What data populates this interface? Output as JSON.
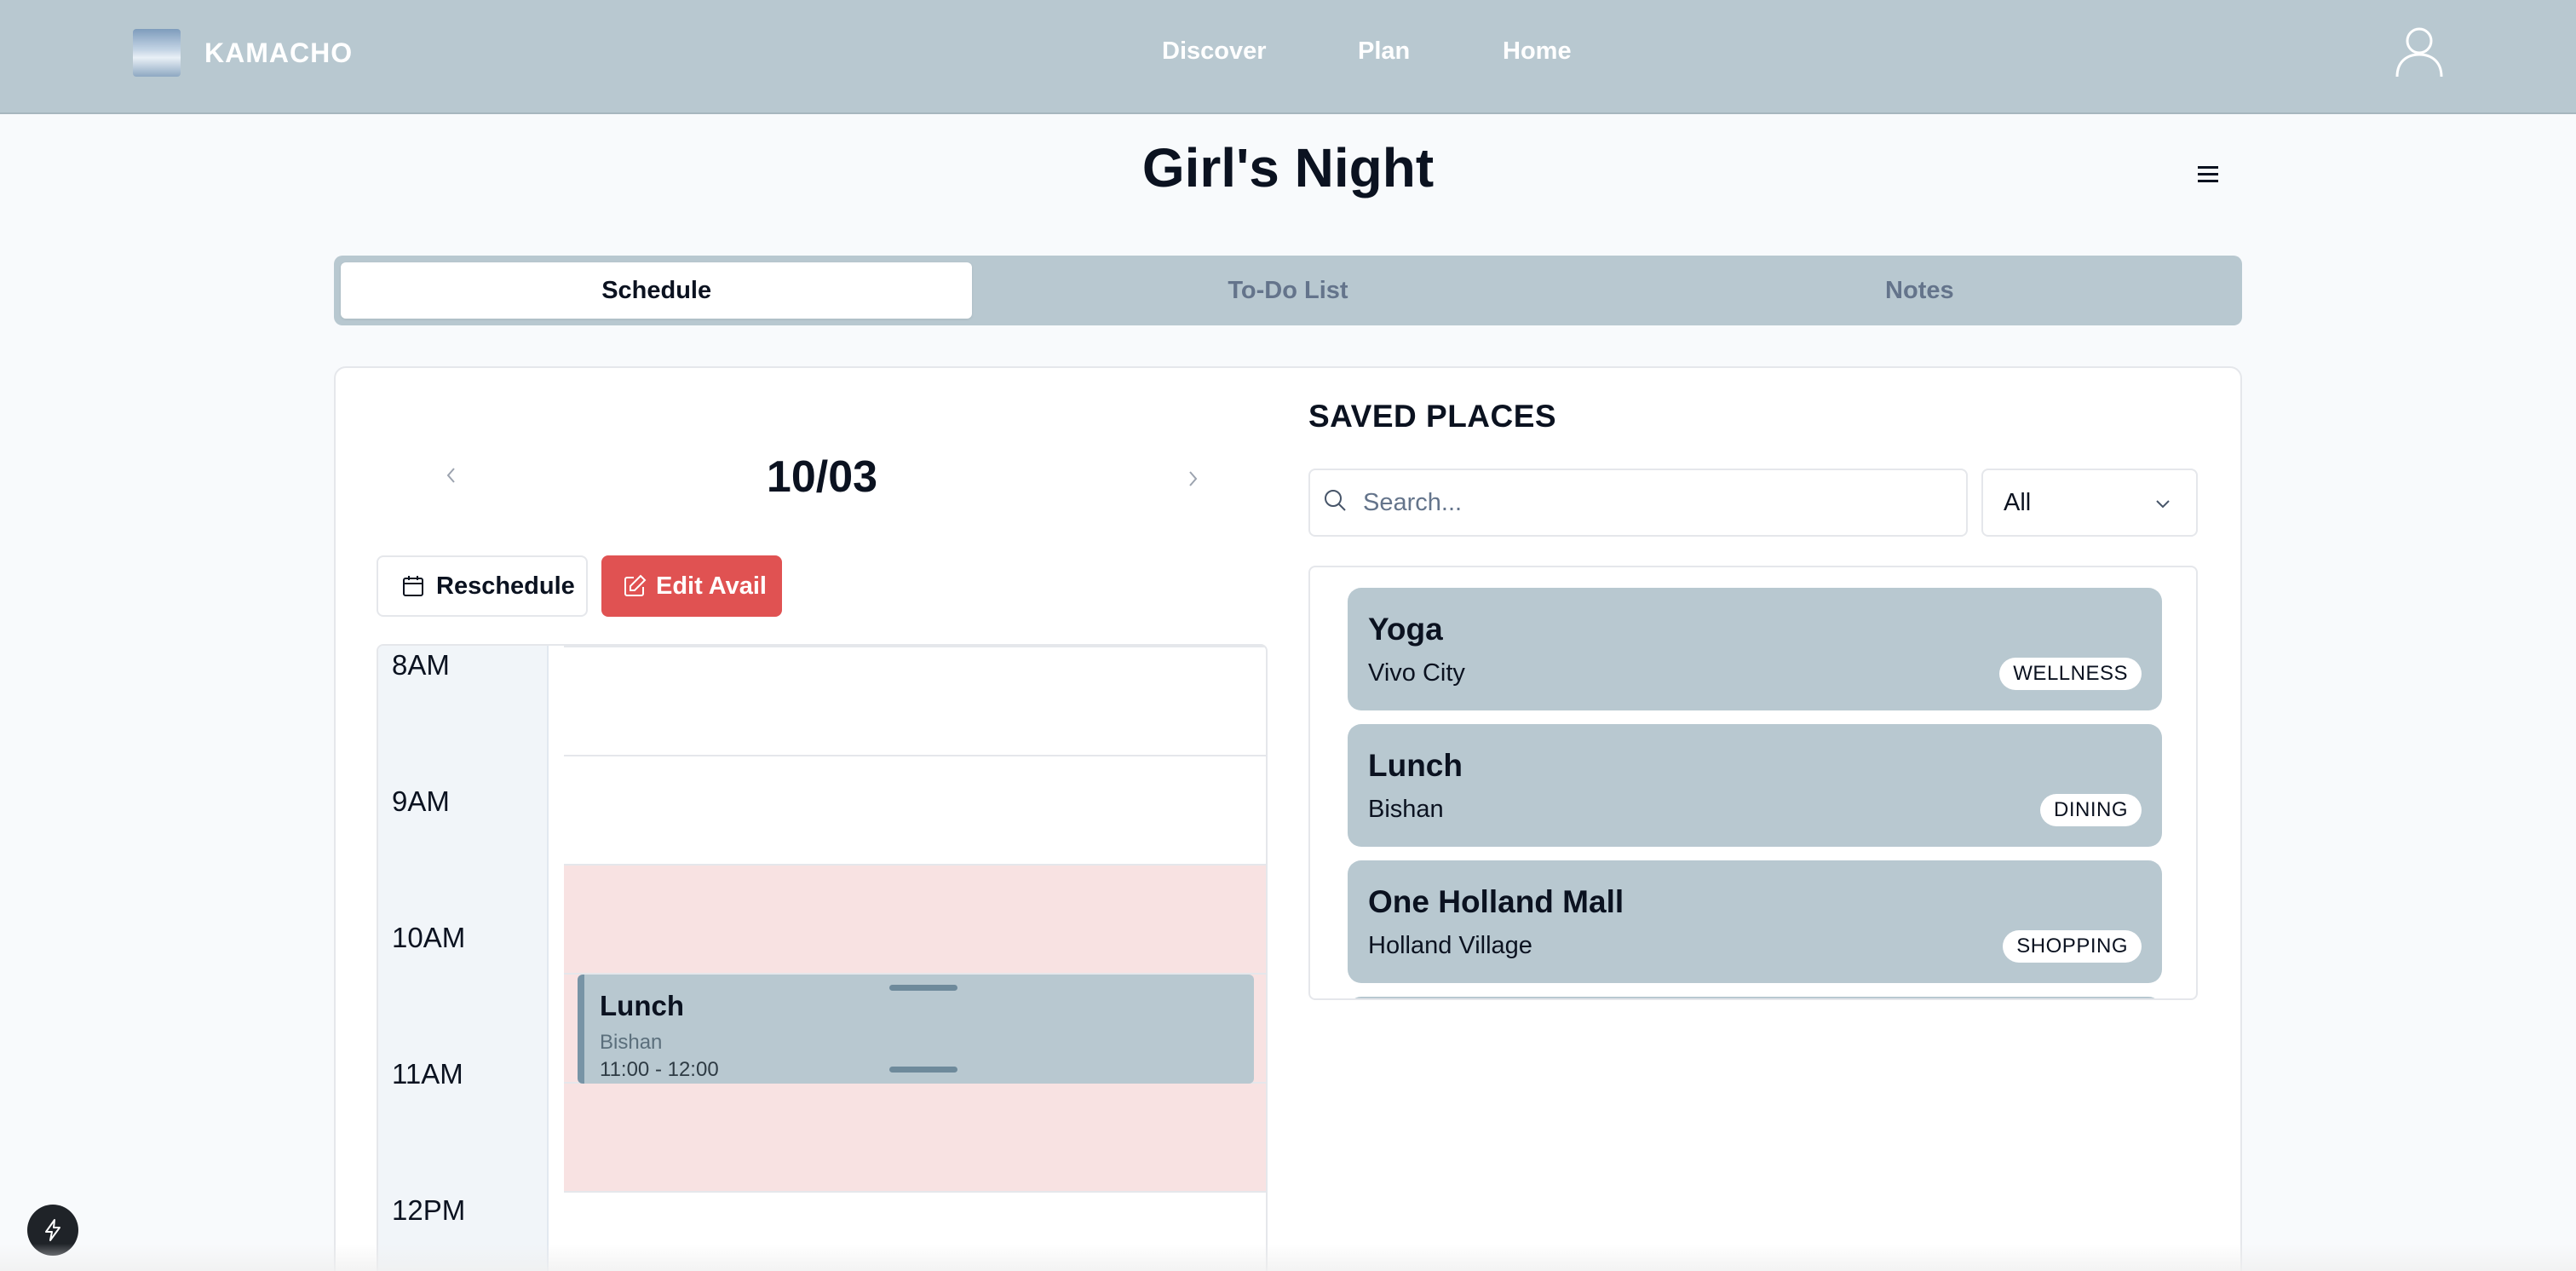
{
  "app": {
    "brand": "KAMACHO"
  },
  "nav": {
    "discover": "Discover",
    "plan": "Plan",
    "home": "Home"
  },
  "page": {
    "title": "Girl's Night"
  },
  "tabs": [
    {
      "label": "Schedule",
      "active": true
    },
    {
      "label": "To-Do List",
      "active": false
    },
    {
      "label": "Notes",
      "active": false
    }
  ],
  "schedule": {
    "date": "10/03",
    "reschedule_label": "Reschedule",
    "edit_avail_label": "Edit Avail",
    "times": [
      "8AM",
      "9AM",
      "10AM",
      "11AM",
      "12PM"
    ],
    "event": {
      "title": "Lunch",
      "location": "Bishan",
      "time": "11:00 - 12:00"
    }
  },
  "saved_places": {
    "title": "SAVED PLACES",
    "search_placeholder": "Search...",
    "filter_value": "All",
    "items": [
      {
        "name": "Yoga",
        "location": "Vivo City",
        "category": "WELLNESS"
      },
      {
        "name": "Lunch",
        "location": "Bishan",
        "category": "DINING"
      },
      {
        "name": "One Holland Mall",
        "location": "Holland Village",
        "category": "SHOPPING"
      }
    ]
  },
  "colors": {
    "nav_bg": "#b8c8d0",
    "accent_red": "#e05252",
    "unavailable_bg": "#f8e2e2",
    "card_bg": "#b8c8d0"
  },
  "icons": {
    "user": "user-icon",
    "menu": "hamburger-menu-icon",
    "calendar": "calendar-icon",
    "edit": "edit-icon",
    "search": "search-icon",
    "fab": "lightning-icon"
  }
}
